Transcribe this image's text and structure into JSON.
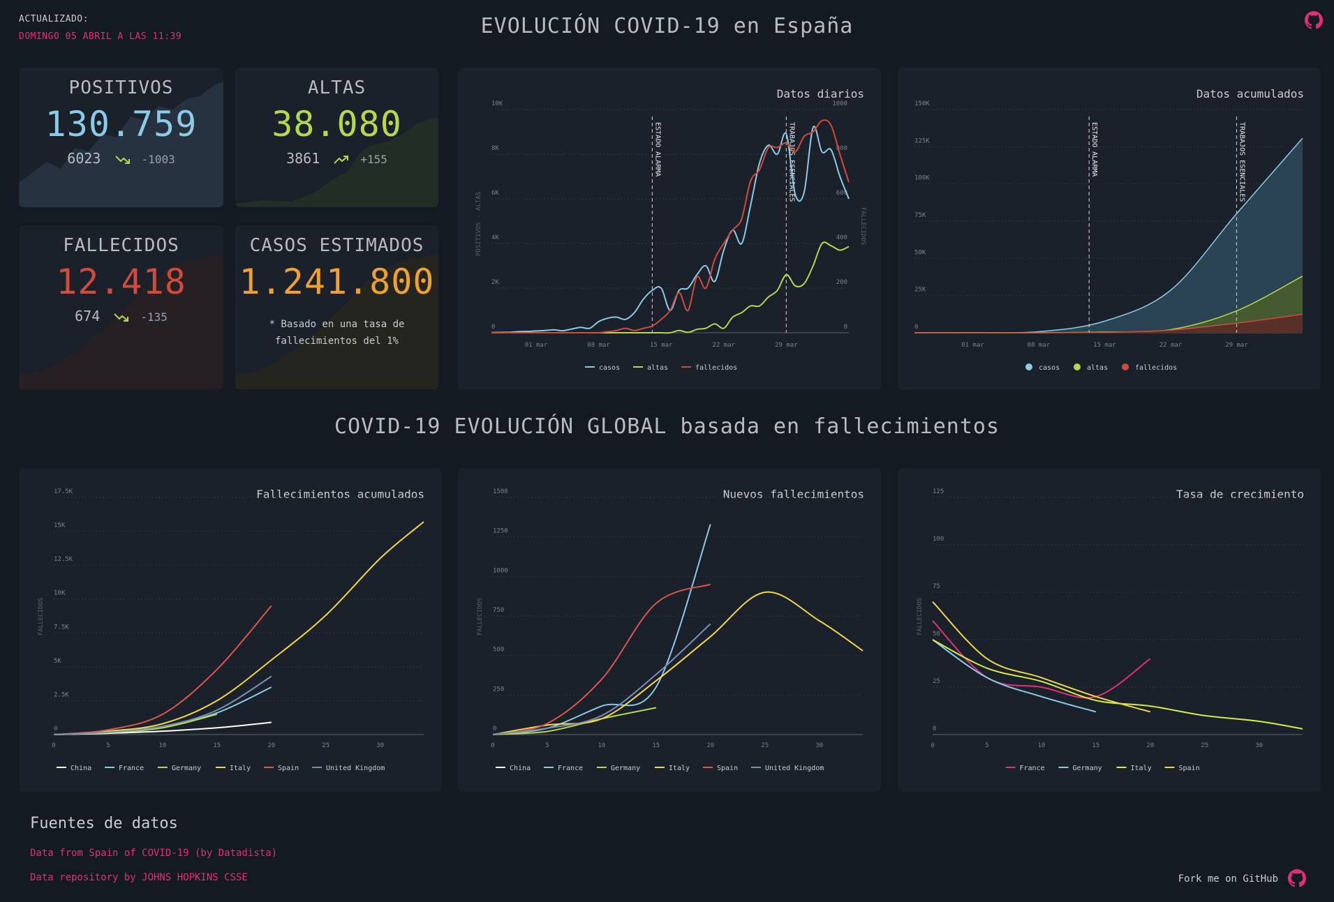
{
  "header": {
    "updated_label": "ACTUALIZADO:",
    "updated_value": "DOMINGO 05 ABRIL A LAS 11:39",
    "title": "EVOLUCIÓN COVID-19 en España"
  },
  "kpis": {
    "positivos": {
      "title": "POSITIVOS",
      "value": "130.759",
      "daily": "6023",
      "delta": "-1003",
      "color": "#8ccbe8",
      "trend": "down"
    },
    "altas": {
      "title": "ALTAS",
      "value": "38.080",
      "daily": "3861",
      "delta": "+155",
      "color": "#b6d84e",
      "trend": "up"
    },
    "fallecidos": {
      "title": "FALLECIDOS",
      "value": "12.418",
      "daily": "674",
      "delta": "-135",
      "color": "#d14b3b",
      "trend": "down"
    },
    "estimados": {
      "title": "CASOS ESTIMADOS",
      "value": "1.241.800",
      "note_line1": "* Basado en una tasa de",
      "note_line2": "fallecimientos del 1%",
      "color": "#f0a030"
    }
  },
  "daily_chart": {
    "title": "Datos diarios",
    "ylabel_left": "POSITIVOS - ALTAS",
    "ylabel_right": "FALLECIDOS",
    "left_ticks": [
      "0",
      "2K",
      "4K",
      "6K",
      "8K",
      "10K"
    ],
    "right_ticks": [
      "0",
      "200",
      "400",
      "600",
      "800",
      "1000"
    ],
    "x_ticks": [
      "01 mar",
      "08 mar",
      "15 mar",
      "22 mar",
      "29 mar"
    ],
    "annotations": [
      "ESTADO ALARMA",
      "TRABAJOS ESENCIALES"
    ],
    "legend": [
      "casos",
      "altas",
      "fallecidos"
    ]
  },
  "cumulative_chart": {
    "title": "Datos acumulados",
    "y_ticks": [
      "0",
      "25K",
      "50K",
      "75K",
      "100K",
      "125K",
      "150K"
    ],
    "x_ticks": [
      "01 mar",
      "08 mar",
      "15 mar",
      "22 mar",
      "29 mar"
    ],
    "annotations": [
      "ESTADO ALARMA",
      "TRABAJOS ESENCIALES"
    ],
    "legend": [
      "casos",
      "altas",
      "fallecidos"
    ]
  },
  "global_section_title": "COVID-19 EVOLUCIÓN GLOBAL basada en fallecimientos",
  "global_charts": {
    "cumulative": {
      "title": "Fallecimientos acumulados",
      "ylabel": "FALLECIDOS",
      "y_ticks": [
        "0",
        "2.5K",
        "5K",
        "7.5K",
        "10K",
        "12.5K",
        "15K",
        "17.5K"
      ],
      "x_ticks": [
        "0",
        "5",
        "10",
        "15",
        "20",
        "25",
        "30"
      ],
      "legend": [
        "China",
        "France",
        "Germany",
        "Italy",
        "Spain",
        "United Kingdom"
      ]
    },
    "new": {
      "title": "Nuevos fallecimientos",
      "ylabel": "FALLECIDOS",
      "y_ticks": [
        "0",
        "250",
        "500",
        "750",
        "1000",
        "1250",
        "1500"
      ],
      "x_ticks": [
        "0",
        "5",
        "10",
        "15",
        "20",
        "25",
        "30"
      ],
      "legend": [
        "China",
        "France",
        "Germany",
        "Italy",
        "Spain",
        "United Kingdom"
      ]
    },
    "growth": {
      "title": "Tasa de crecimiento",
      "ylabel": "FALLECIDOS",
      "y_ticks": [
        "0",
        "25",
        "50",
        "75",
        "100",
        "125"
      ],
      "x_ticks": [
        "0",
        "5",
        "10",
        "15",
        "20",
        "25",
        "30"
      ],
      "legend": [
        "France",
        "Germany",
        "Italy",
        "Spain"
      ]
    }
  },
  "colors": {
    "casos": "#8ccbe8",
    "altas": "#b6d84e",
    "fallecidos": "#d14b3b",
    "China": "#ffffff",
    "France": "#8ccbe8",
    "Germany": "#b6d84e",
    "Italy": "#f2d64b",
    "Spain": "#d9584a",
    "United Kingdom": "#7a8fb5",
    "growth_France": "#e0307a",
    "growth_Germany": "#8ccbe8",
    "growth_Italy": "#d6ea48",
    "growth_Spain": "#f2d64b"
  },
  "footer": {
    "sources_title": "Fuentes de datos",
    "link1": "Data from Spain of COVID-19 (by Datadista)",
    "link2": "Data repository by JOHNS HOPKINS CSSE",
    "fork": "Fork me on GitHub"
  },
  "chart_data": [
    {
      "type": "line",
      "title": "Datos diarios",
      "x": [
        "25 feb",
        "26 feb",
        "27 feb",
        "28 feb",
        "29 feb",
        "01 mar",
        "02 mar",
        "03 mar",
        "04 mar",
        "05 mar",
        "06 mar",
        "07 mar",
        "08 mar",
        "09 mar",
        "10 mar",
        "11 mar",
        "12 mar",
        "13 mar",
        "14 mar",
        "15 mar",
        "16 mar",
        "17 mar",
        "18 mar",
        "19 mar",
        "20 mar",
        "21 mar",
        "22 mar",
        "23 mar",
        "24 mar",
        "25 mar",
        "26 mar",
        "27 mar",
        "28 mar",
        "29 mar",
        "30 mar",
        "31 mar",
        "01 abr",
        "02 abr",
        "03 abr",
        "04 abr",
        "05 abr"
      ],
      "series": [
        {
          "name": "casos",
          "axis": "left",
          "values": [
            10,
            20,
            20,
            50,
            60,
            80,
            100,
            130,
            90,
            170,
            240,
            200,
            500,
            650,
            700,
            600,
            900,
            1500,
            1900,
            2000,
            1000,
            1900,
            2000,
            2600,
            3000,
            2300,
            3700,
            4600,
            4000,
            5700,
            7600,
            8400,
            8000,
            8900,
            6200,
            6300,
            9200,
            8100,
            8200,
            7000,
            6000
          ]
        },
        {
          "name": "altas",
          "axis": "left",
          "values": [
            0,
            0,
            0,
            0,
            0,
            0,
            0,
            0,
            0,
            0,
            0,
            0,
            0,
            0,
            0,
            0,
            0,
            0,
            0,
            0,
            0,
            100,
            20,
            150,
            200,
            400,
            200,
            700,
            900,
            1200,
            1200,
            1600,
            1900,
            2600,
            2100,
            2200,
            3000,
            4000,
            3900,
            3700,
            3861
          ]
        },
        {
          "name": "fallecidos",
          "axis": "right",
          "values": [
            0,
            0,
            0,
            0,
            0,
            0,
            0,
            0,
            0,
            0,
            0,
            0,
            0,
            5,
            10,
            20,
            10,
            20,
            30,
            60,
            100,
            180,
            100,
            250,
            200,
            330,
            400,
            460,
            510,
            680,
            730,
            830,
            830,
            850,
            810,
            880,
            900,
            950,
            930,
            800,
            674
          ]
        }
      ],
      "left_ylim": [
        0,
        10000
      ],
      "right_ylim": [
        0,
        1000
      ]
    },
    {
      "type": "area",
      "title": "Datos acumulados",
      "x": [
        "25 feb",
        "01 mar",
        "08 mar",
        "15 mar",
        "22 mar",
        "29 mar",
        "05 abr"
      ],
      "series": [
        {
          "name": "casos",
          "values": [
            0,
            100,
            700,
            7800,
            28600,
            80000,
            130759
          ]
        },
        {
          "name": "altas",
          "values": [
            0,
            0,
            0,
            500,
            2100,
            14700,
            38080
          ]
        },
        {
          "name": "fallecidos",
          "values": [
            0,
            0,
            20,
            300,
            1800,
            6500,
            12418
          ]
        }
      ],
      "ylim": [
        0,
        150000
      ]
    },
    {
      "type": "line",
      "title": "Fallecimientos acumulados",
      "x": [
        0,
        5,
        10,
        15,
        20,
        25,
        30,
        34
      ],
      "series": [
        {
          "name": "China",
          "values": [
            0,
            100,
            250,
            500,
            900,
            null,
            null,
            null
          ]
        },
        {
          "name": "France",
          "values": [
            0,
            200,
            600,
            1600,
            3500,
            null,
            null,
            null
          ]
        },
        {
          "name": "Germany",
          "values": [
            0,
            150,
            500,
            1500,
            null,
            null,
            null,
            null
          ]
        },
        {
          "name": "Italy",
          "values": [
            0,
            250,
            800,
            2500,
            5500,
            8800,
            13000,
            15700
          ]
        },
        {
          "name": "Spain",
          "values": [
            0,
            350,
            1500,
            4800,
            9500,
            null,
            null,
            null
          ]
        },
        {
          "name": "United Kingdom",
          "values": [
            0,
            180,
            600,
            1800,
            4300,
            null,
            null,
            null
          ]
        }
      ],
      "ylim": [
        0,
        17500
      ]
    },
    {
      "type": "line",
      "title": "Nuevos fallecimientos",
      "x": [
        0,
        5,
        10,
        15,
        20,
        25,
        30,
        34
      ],
      "series": [
        {
          "name": "France",
          "values": [
            0,
            40,
            180,
            300,
            1330,
            null,
            null,
            null
          ]
        },
        {
          "name": "Germany",
          "values": [
            0,
            20,
            100,
            170,
            null,
            null,
            null,
            null
          ]
        },
        {
          "name": "Italy",
          "values": [
            0,
            60,
            100,
            340,
            620,
            900,
            720,
            530
          ]
        },
        {
          "name": "Spain",
          "values": [
            0,
            70,
            350,
            830,
            950,
            null,
            null,
            null
          ]
        },
        {
          "name": "United Kingdom",
          "values": [
            0,
            40,
            120,
            380,
            700,
            null,
            null,
            null
          ]
        }
      ],
      "ylim": [
        0,
        1500
      ]
    },
    {
      "type": "line",
      "title": "Tasa de crecimiento",
      "x": [
        0,
        5,
        10,
        15,
        20,
        25,
        30,
        34
      ],
      "series": [
        {
          "name": "France",
          "values": [
            60,
            30,
            25,
            20,
            40,
            null,
            null,
            null
          ]
        },
        {
          "name": "Germany",
          "values": [
            50,
            30,
            20,
            12,
            null,
            null,
            null,
            null
          ]
        },
        {
          "name": "Italy",
          "values": [
            50,
            35,
            28,
            18,
            15,
            10,
            7,
            3
          ]
        },
        {
          "name": "Spain",
          "values": [
            70,
            40,
            30,
            20,
            12,
            null,
            null,
            null
          ]
        }
      ],
      "ylim": [
        0,
        125
      ]
    }
  ]
}
